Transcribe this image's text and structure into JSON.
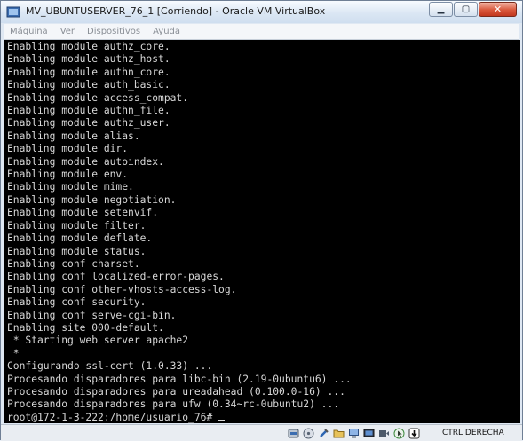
{
  "window": {
    "title": "MV_UBUNTUSERVER_76_1 [Corriendo] - Oracle VM VirtualBox",
    "minimize_label": "▁",
    "maximize_label": "▢",
    "close_label": "✕"
  },
  "menu": {
    "items": [
      "Máquina",
      "Ver",
      "Dispositivos",
      "Ayuda"
    ]
  },
  "console": {
    "lines": [
      "Enabling module authz_core.",
      "Enabling module authz_host.",
      "Enabling module authn_core.",
      "Enabling module auth_basic.",
      "Enabling module access_compat.",
      "Enabling module authn_file.",
      "Enabling module authz_user.",
      "Enabling module alias.",
      "Enabling module dir.",
      "Enabling module autoindex.",
      "Enabling module env.",
      "Enabling module mime.",
      "Enabling module negotiation.",
      "Enabling module setenvif.",
      "Enabling module filter.",
      "Enabling module deflate.",
      "Enabling module status.",
      "Enabling conf charset.",
      "Enabling conf localized-error-pages.",
      "Enabling conf other-vhosts-access-log.",
      "Enabling conf security.",
      "Enabling conf serve-cgi-bin.",
      "Enabling site 000-default.",
      " * Starting web server apache2",
      " *",
      "Configurando ssl-cert (1.0.33) ...",
      "Procesando disparadores para libc-bin (2.19-0ubuntu6) ...",
      "Procesando disparadores para ureadahead (0.100.0-16) ...",
      "Procesando disparadores para ufw (0.34~rc-0ubuntu2) ..."
    ],
    "prompt": "root@172-1-3-222:/home/usuario_76#"
  },
  "statusbar": {
    "icons": [
      "hard-disk-icon",
      "optical-drive-icon",
      "usb-icon",
      "shared-folders-icon",
      "network-icon",
      "display-icon",
      "video-capture-icon",
      "mouse-integration-icon",
      "host-key-icon"
    ],
    "host_key": "CTRL DERECHA"
  },
  "colors": {
    "console_bg": "#000000",
    "console_fg": "#d8d8d8",
    "close_button": "#d9573b"
  }
}
